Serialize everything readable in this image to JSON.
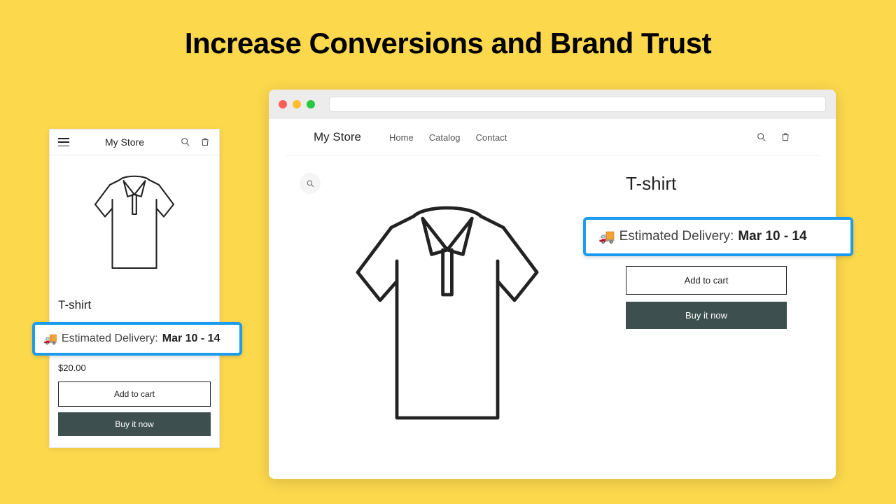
{
  "headline": "Increase Conversions and Brand Trust",
  "store_name": "My Store",
  "nav": {
    "home": "Home",
    "catalog": "Catalog",
    "contact": "Contact"
  },
  "product": {
    "title": "T-shirt",
    "price": "$20.00"
  },
  "buttons": {
    "add_to_cart": "Add to cart",
    "buy_now": "Buy it now"
  },
  "delivery": {
    "icon": "🚚",
    "label": "Estimated Delivery: ",
    "range": "Mar 10 - 14"
  },
  "colors": {
    "highlight_border": "#1b9cf0",
    "buy_button": "#3d4f4f",
    "background": "#fcd84d"
  }
}
